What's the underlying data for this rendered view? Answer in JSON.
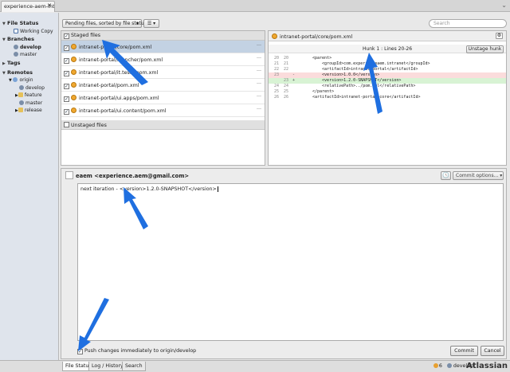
{
  "window_tab": {
    "title": "experience-aem-intranet",
    "close": "✕"
  },
  "tabbar_menu": "⌄",
  "sidebar": {
    "file_status": {
      "label": "File Status",
      "items": [
        {
          "label": "Working Copy"
        }
      ]
    },
    "branches": {
      "label": "Branches",
      "items": [
        {
          "label": "develop",
          "selected": true
        },
        {
          "label": "master"
        }
      ]
    },
    "tags": {
      "label": "Tags"
    },
    "remotes": {
      "label": "Remotes",
      "origin": "origin",
      "items": [
        {
          "label": "develop"
        },
        {
          "label": "feature"
        },
        {
          "label": "master"
        },
        {
          "label": "release"
        }
      ]
    }
  },
  "toolbar": {
    "sort": "Pending files, sorted by file status",
    "sort_arrow": "▾",
    "view_icon": "☰ ▾",
    "search_placeholder": "Search"
  },
  "staged": {
    "header": "Staged files",
    "files": [
      {
        "path": "intranet-portal/core/pom.xml",
        "selected": true
      },
      {
        "path": "intranet-portal/launcher/pom.xml"
      },
      {
        "path": "intranet-portal/it.tests/pom.xml"
      },
      {
        "path": "intranet-portal/pom.xml"
      },
      {
        "path": "intranet-portal/ui.apps/pom.xml"
      },
      {
        "path": "intranet-portal/ui.content/pom.xml"
      }
    ],
    "more": "···"
  },
  "unstaged": {
    "header": "Unstaged files"
  },
  "diff": {
    "file": "intranet-portal/core/pom.xml",
    "gear": "⚙",
    "hunk_label": "Hunk 1 : Lines 20-26",
    "unstage_hunk": "Unstage hunk",
    "lines": [
      {
        "old": "20",
        "new": "20",
        "mark": "",
        "text": "<parent>",
        "type": "ctx"
      },
      {
        "old": "21",
        "new": "21",
        "mark": "",
        "text": "    <groupId>com.experienceaem.intranet</groupId>",
        "type": "ctx"
      },
      {
        "old": "22",
        "new": "22",
        "mark": "",
        "text": "    <artifactId>intranet-portal</artifactId>",
        "type": "ctx"
      },
      {
        "old": "23",
        "new": "",
        "mark": "-",
        "text": "    <version>1.0.0</version>",
        "type": "del"
      },
      {
        "old": "",
        "new": "23",
        "mark": "+",
        "text": "    <version>1.2.0-SNAPSHOT</version>",
        "type": "add"
      },
      {
        "old": "24",
        "new": "24",
        "mark": "",
        "text": "    <relativePath>../pom.xml</relativePath>",
        "type": "ctx"
      },
      {
        "old": "25",
        "new": "25",
        "mark": "",
        "text": "</parent>",
        "type": "ctx"
      },
      {
        "old": "26",
        "new": "26",
        "mark": "",
        "text": "<artifactId>intranet-portal.core</artifactId>",
        "type": "ctx"
      }
    ]
  },
  "commit": {
    "author": "eaem <experience.aem@gmail.com>",
    "history_icon": "🕓",
    "options": "Commit options... ▾",
    "message": "next iteration - <version>1.2.0-SNAPSHOT</version>",
    "push_label": "Push changes immediately to origin/develop",
    "push_checked": true,
    "commit_btn": "Commit",
    "cancel_btn": "Cancel"
  },
  "bottom": {
    "tabs": [
      {
        "label": "File Status",
        "active": true
      },
      {
        "label": "Log / History"
      },
      {
        "label": "Search"
      }
    ],
    "pending_count": "6",
    "branch": "develop",
    "brand": "Atlassian"
  },
  "colors": {
    "arrow": "#1f6fe0",
    "selection": "#c3d2e3",
    "deleted": "#fbdcdc",
    "added": "#d8f3d4"
  }
}
